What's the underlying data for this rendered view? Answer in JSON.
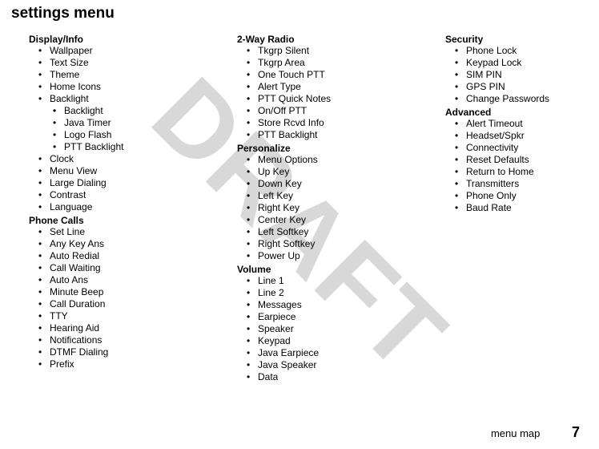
{
  "watermark": "DRAFT",
  "title": "settings menu",
  "columns": [
    {
      "sections": [
        {
          "title": "Display/Info",
          "items": [
            "Wallpaper",
            "Text Size",
            "Theme",
            "Home Icons",
            "Backlight"
          ],
          "subitems": [
            "Backlight",
            "Java Timer",
            "Logo Flash",
            "PTT Backlight"
          ],
          "items_after": [
            "Clock",
            "Menu View",
            "Large Dialing",
            "Contrast",
            "Language"
          ]
        },
        {
          "title": "Phone Calls",
          "items": [
            "Set Line",
            "Any Key Ans",
            "Auto Redial",
            "Call Waiting",
            "Auto Ans",
            "Minute Beep",
            "Call Duration",
            "TTY",
            "Hearing Aid",
            "Notifications",
            "DTMF Dialing",
            "Prefix"
          ]
        }
      ]
    },
    {
      "sections": [
        {
          "title": "2-Way Radio",
          "items": [
            "Tkgrp Silent",
            "Tkgrp Area",
            "One Touch PTT",
            "Alert Type",
            "PTT Quick Notes",
            "On/Off PTT",
            "Store Rcvd Info",
            "PTT Backlight"
          ]
        },
        {
          "title": "Personalize",
          "items": [
            "Menu Options",
            "Up Key",
            "Down Key",
            "Left Key",
            "Right Key",
            "Center Key",
            "Left Softkey",
            "Right Softkey",
            "Power Up"
          ]
        },
        {
          "title": "Volume",
          "items": [
            "Line 1",
            "Line 2",
            "Messages",
            "Earpiece",
            "Speaker",
            "Keypad",
            "Java Earpiece",
            "Java Speaker",
            "Data"
          ]
        }
      ]
    },
    {
      "sections": [
        {
          "title": "Security",
          "items": [
            "Phone Lock",
            "Keypad Lock",
            "SIM PIN",
            "GPS PIN",
            "Change Passwords"
          ]
        },
        {
          "title": "Advanced",
          "items": [
            "Alert Timeout",
            "Headset/Spkr",
            "Connectivity",
            "Reset Defaults",
            "Return to Home",
            "Transmitters",
            "Phone Only",
            "Baud Rate"
          ]
        }
      ]
    }
  ],
  "footer": {
    "label": "menu map",
    "page": "7"
  }
}
